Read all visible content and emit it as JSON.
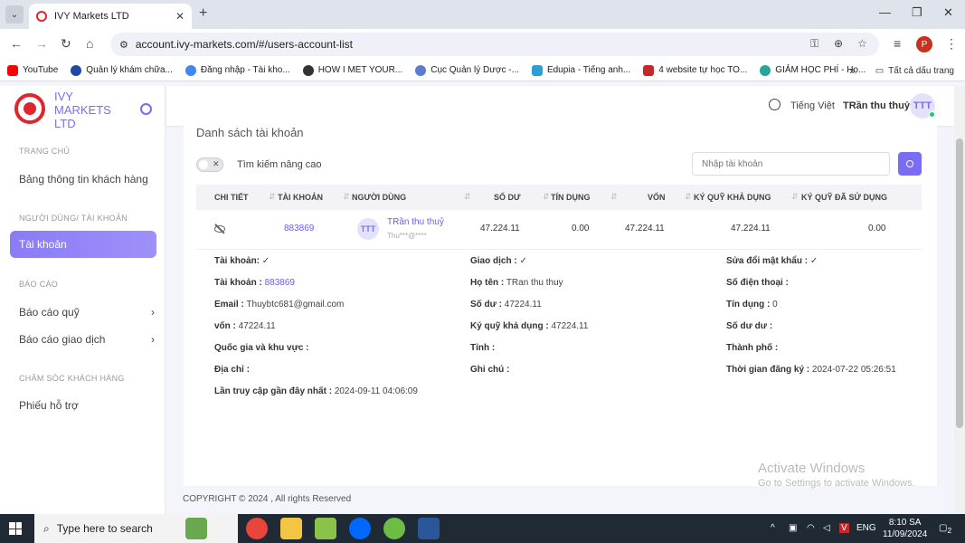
{
  "browser": {
    "tab_title": "IVY Markets LTD",
    "url": "account.ivy-markets.com/#/users-account-list",
    "profile_initial": "P",
    "bookmarks": [
      "YouTube",
      "Quản lý khám chữa...",
      "Đăng nhập - Tài kho...",
      "HOW I MET YOUR...",
      "Cục Quản lý Dược -...",
      "Edupia - Tiếng anh...",
      "4 website tự học TO...",
      "GIẢM HỌC PHÍ - Họ..."
    ],
    "bookmarks_more": "»",
    "all_bookmarks": "Tất cả dấu trang"
  },
  "sidebar": {
    "brand": "IVY MARKETS LTD",
    "sections": [
      {
        "title": "TRANG CHỦ",
        "items": [
          "Bảng thông tin khách hàng"
        ]
      },
      {
        "title": "NGƯỜI DÙNG/ TÀI KHOẢN",
        "items": [
          "Tài khoản"
        ]
      },
      {
        "title": "BÁO CÁO",
        "items": [
          "Báo cáo quỹ",
          "Báo cáo giao dịch"
        ]
      },
      {
        "title": "CHĂM SÓC KHÁCH HÀNG",
        "items": [
          "Phiếu hỗ trợ"
        ]
      }
    ]
  },
  "topbar": {
    "language": "Tiếng Việt",
    "username": "TRần thu thuỷ",
    "avatar": "TTT"
  },
  "page": {
    "title": "Danh sách tài khoản",
    "advanced_search": "Tìm kiếm nâng cao",
    "search_placeholder": "Nhập tài khoản"
  },
  "table": {
    "columns": [
      "CHI TIẾT",
      "TÀI KHOẢN",
      "NGƯỜI DÙNG",
      "SỐ DƯ",
      "TÍN DỤNG",
      "VỐN",
      "KÝ QUỸ KHẢ DỤNG",
      "KÝ QUỸ ĐÃ SỬ DỤNG"
    ],
    "row": {
      "account": "883869",
      "avatar": "TTT",
      "user_name": "TRần thu thuỷ",
      "user_email": "Thu***@****",
      "balance": "47.224.11",
      "credit": "0.00",
      "capital": "47.224.11",
      "free_margin": "47.224.11",
      "used_margin": "0.00"
    }
  },
  "detail": {
    "col1": [
      {
        "label": "Tài khoản:",
        "value": "✓"
      },
      {
        "label": "Tài khoản :",
        "value": "883869"
      },
      {
        "label": "Email :",
        "value": "Thuybtc681@gmail.com"
      },
      {
        "label": "vốn :",
        "value": "47224.11"
      },
      {
        "label": "Quốc gia và khu vực :",
        "value": ""
      },
      {
        "label": "Địa chỉ :",
        "value": ""
      },
      {
        "label": "Lần truy cập gần đây nhất :",
        "value": "2024-09-11 04:06:09"
      }
    ],
    "col2": [
      {
        "label": "Giao dịch :",
        "value": "✓"
      },
      {
        "label": "Họ tên :",
        "value": "TRan thu thuy"
      },
      {
        "label": "Số dư :",
        "value": "47224.11"
      },
      {
        "label": "Ký quỹ khả dụng :",
        "value": "47224.11"
      },
      {
        "label": "Tỉnh :",
        "value": ""
      },
      {
        "label": "Ghi chú :",
        "value": ""
      }
    ],
    "col3": [
      {
        "label": "Sửa đổi mật khẩu :",
        "value": "✓"
      },
      {
        "label": "Số điện thoại :",
        "value": ""
      },
      {
        "label": "Tín dụng :",
        "value": "0"
      },
      {
        "label": "Số dư dư :",
        "value": ""
      },
      {
        "label": "Thành phố :",
        "value": ""
      },
      {
        "label": "Thời gian đăng ký :",
        "value": "2024-07-22 05:26:51"
      }
    ]
  },
  "footer": "COPYRIGHT © 2024 , All rights Reserved",
  "watermark": {
    "line1": "Activate Windows",
    "line2": "Go to Settings to activate Windows."
  },
  "taskbar": {
    "search_placeholder": "Type here to search",
    "language": "ENG",
    "time": "8:10 SA",
    "date": "11/09/2024",
    "notifications": "2"
  },
  "colors": {
    "accent": "#7b6cf6",
    "brand_red": "#e0262d"
  }
}
